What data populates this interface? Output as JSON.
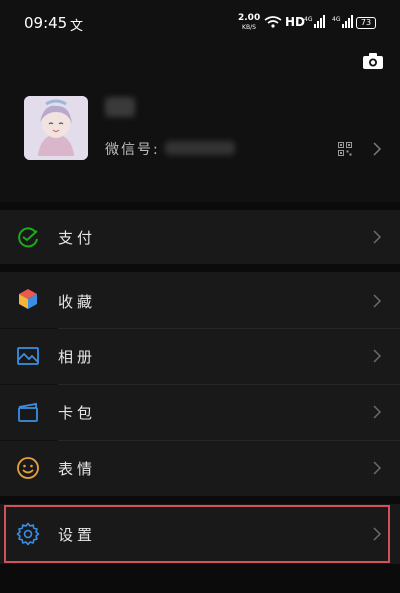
{
  "status_bar": {
    "time": "09:45",
    "ime_glyph": "文",
    "net_speed_value": "2.00",
    "net_speed_unit": "KB/S",
    "hd_label": "HD",
    "battery": "73"
  },
  "profile": {
    "nickname": "",
    "wechat_id_label": "微信号:",
    "wechat_id_value": ""
  },
  "menu": {
    "pay": "支付",
    "favorites": "收藏",
    "album": "相册",
    "cards": "卡包",
    "stickers": "表情",
    "settings": "设置"
  },
  "colors": {
    "background": "#111111",
    "item_bg": "#191919",
    "pay_green": "#1aad19",
    "accent_blue": "#3a8ee6",
    "sticker_orange": "#e6a23c",
    "highlight_red": "#d2525a"
  },
  "icons": [
    "camera-icon",
    "qr-code-icon",
    "chevron-right-icon",
    "pay-icon",
    "favorites-icon",
    "album-icon",
    "cards-icon",
    "stickers-icon",
    "settings-gear-icon"
  ]
}
